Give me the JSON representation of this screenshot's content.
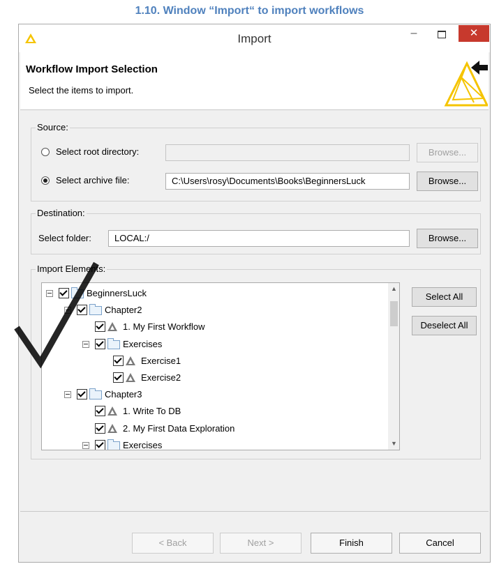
{
  "caption": "1.10. Window “Import“ to import workflows",
  "window": {
    "title": "Import",
    "minimize_icon": "minimize-icon",
    "maximize_icon": "maximize-icon",
    "close_icon": "close-icon",
    "close_symbol": "✕",
    "minimize_symbol": "–"
  },
  "header": {
    "title": "Workflow Import Selection",
    "subtitle": "Select the items to import."
  },
  "source": {
    "legend": "Source:",
    "root_label": "Select root directory:",
    "root_value": "",
    "root_browse": "Browse...",
    "archive_label": "Select archive file:",
    "archive_value": "C:\\Users\\rosy\\Documents\\Books\\BeginnersLuck",
    "archive_browse": "Browse...",
    "selected": "archive"
  },
  "destination": {
    "legend": "Destination:",
    "folder_label": "Select folder:",
    "folder_value": "LOCAL:/",
    "browse": "Browse..."
  },
  "import_elements": {
    "legend": "Import Elements:",
    "select_all": "Select All",
    "deselect_all": "Deselect All",
    "tree": [
      {
        "label": "BeginnersLuck",
        "kind": "folder",
        "level": 0,
        "expanded": true,
        "checked": true
      },
      {
        "label": "Chapter2",
        "kind": "folder",
        "level": 1,
        "expanded": true,
        "checked": true
      },
      {
        "label": "1. My First Workflow",
        "kind": "workflow",
        "level": 2,
        "checked": true
      },
      {
        "label": "Exercises",
        "kind": "folder",
        "level": 2,
        "expanded": true,
        "checked": true
      },
      {
        "label": "Exercise1",
        "kind": "workflow",
        "level": 3,
        "checked": true
      },
      {
        "label": "Exercise2",
        "kind": "workflow",
        "level": 3,
        "checked": true
      },
      {
        "label": "Chapter3",
        "kind": "folder",
        "level": 1,
        "expanded": true,
        "checked": true
      },
      {
        "label": "1. Write To DB",
        "kind": "workflow",
        "level": 2,
        "checked": true
      },
      {
        "label": "2. My First Data Exploration",
        "kind": "workflow",
        "level": 2,
        "checked": true
      },
      {
        "label": "Exercises",
        "kind": "folder",
        "level": 2,
        "expanded": true,
        "checked": true
      }
    ]
  },
  "footer": {
    "back": "< Back",
    "next": "Next >",
    "finish": "Finish",
    "cancel": "Cancel"
  },
  "colors": {
    "caption": "#4f81bd",
    "close": "#c7392d",
    "logo": "#f5c400"
  }
}
